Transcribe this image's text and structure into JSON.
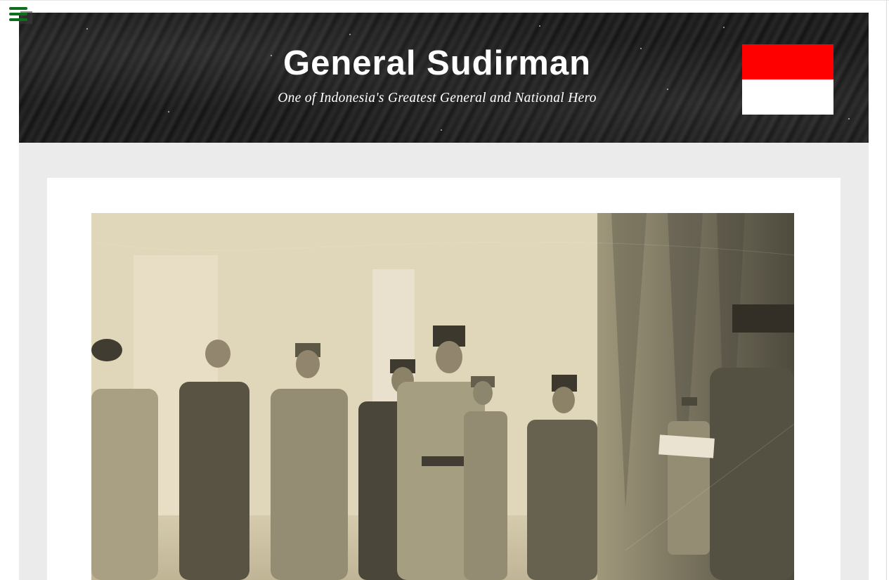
{
  "header": {
    "title": "General Sudirman",
    "tagline": "One of Indonesia's Greatest General and National Hero"
  },
  "menu": {
    "icon": "hamburger-menu-icon",
    "color": "#0f6e1c"
  },
  "flag": {
    "top_color": "#ff0000",
    "bottom_color": "#ffffff"
  },
  "colors": {
    "header_bg": "#1c1c1c",
    "page_bg": "#ebebeb",
    "card_bg": "#ffffff"
  }
}
